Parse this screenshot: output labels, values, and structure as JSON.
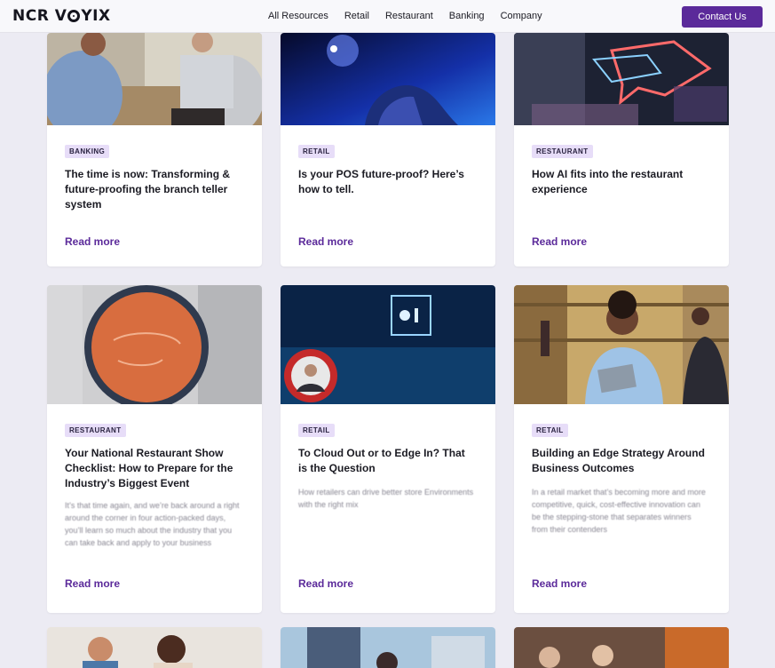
{
  "header": {
    "logo": "NCR VOYIX",
    "nav": [
      "All Resources",
      "Retail",
      "Restaurant",
      "Banking",
      "Company"
    ],
    "contact_label": "Contact Us"
  },
  "cards": [
    {
      "tag": "BANKING",
      "title": "The time is now: Transforming & future-proofing the branch teller system",
      "read_more": "Read more"
    },
    {
      "tag": "RETAIL",
      "title": "Is your POS future-proof? Here’s how to tell.",
      "read_more": "Read more"
    },
    {
      "tag": "RESTAURANT",
      "title": "How AI fits into the restaurant experience",
      "read_more": "Read more"
    },
    {
      "tag": "RESTAURANT",
      "title": "Your National Restaurant Show Checklist: How to Prepare for the Industry’s Biggest Event",
      "desc": "It’s that time again, and we’re back around a right around the corner in four action-packed days, you’ll learn so much about the industry that you can take back and apply to your business",
      "read_more": "Read more"
    },
    {
      "tag": "RETAIL",
      "title": "To Cloud Out or to Edge In? That is the Question",
      "desc": "How retailers can drive better store Environments with the right mix",
      "read_more": "Read more"
    },
    {
      "tag": "RETAIL",
      "title": "Building an Edge Strategy Around Business Outcomes",
      "desc": "In a retail market that’s becoming more and more competitive, quick, cost-effective innovation can be the stepping-stone that separates winners from their contenders",
      "read_more": "Read more"
    }
  ]
}
